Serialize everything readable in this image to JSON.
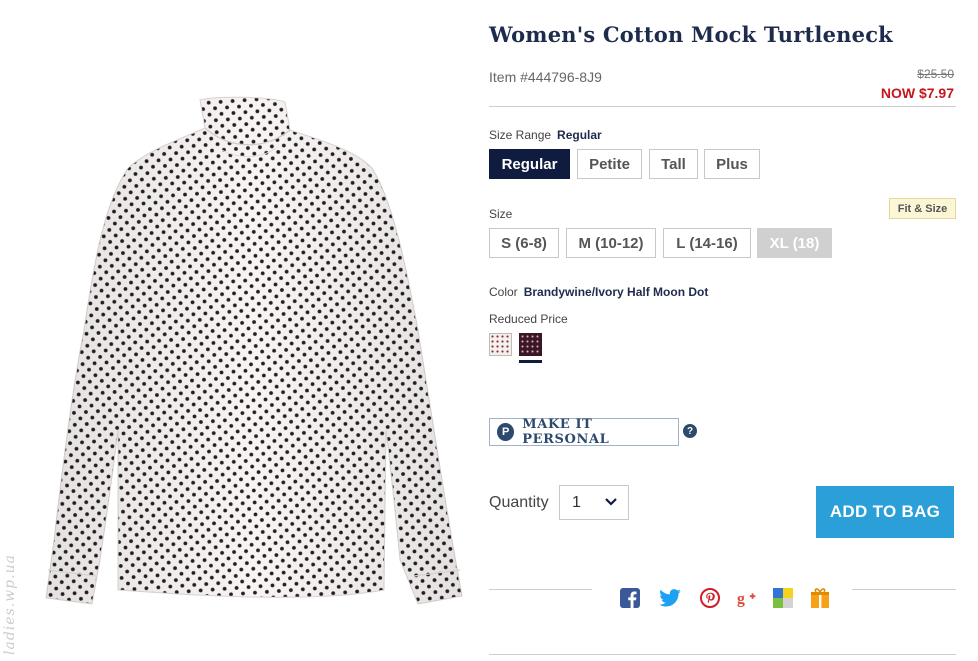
{
  "product": {
    "title": "Women's Cotton Mock Turtleneck",
    "item_number": "Item #444796-8J9",
    "original_price": "$25.50",
    "now_price": "NOW $7.97",
    "image_alt": "polka-dot-turtleneck-image",
    "watermark": "ladies.wp.ua"
  },
  "size_range": {
    "label": "Size Range",
    "selected": "Regular",
    "options": [
      "Regular",
      "Petite",
      "Tall",
      "Plus"
    ]
  },
  "size": {
    "label": "Size",
    "fit_link": "Fit & Size",
    "options": [
      "S (6-8)",
      "M (10-12)",
      "L (14-16)",
      "XL (18)"
    ],
    "unavailable": [
      "XL (18)"
    ]
  },
  "color": {
    "label": "Color",
    "selected": "Brandywine/Ivory Half Moon Dot",
    "group_label": "Reduced Price",
    "swatches": [
      "ivory-dot-swatch",
      "brandywine-dot-swatch"
    ]
  },
  "personalize": {
    "icon_letter": "P",
    "label": "MAKE IT PERSONAL",
    "help": "?"
  },
  "quantity": {
    "label": "Quantity",
    "value": "1"
  },
  "cart": {
    "add_label": "ADD TO BAG"
  },
  "share": {
    "icons": [
      "facebook-icon",
      "twitter-icon",
      "pinterest-icon",
      "google-plus-icon",
      "delicious-icon",
      "gift-icon"
    ]
  },
  "colors": {
    "navy": "#0f1b3f",
    "sale_red": "#c4161c",
    "cta_blue": "#2a9fd8",
    "title_navy": "#1f2b4d"
  }
}
